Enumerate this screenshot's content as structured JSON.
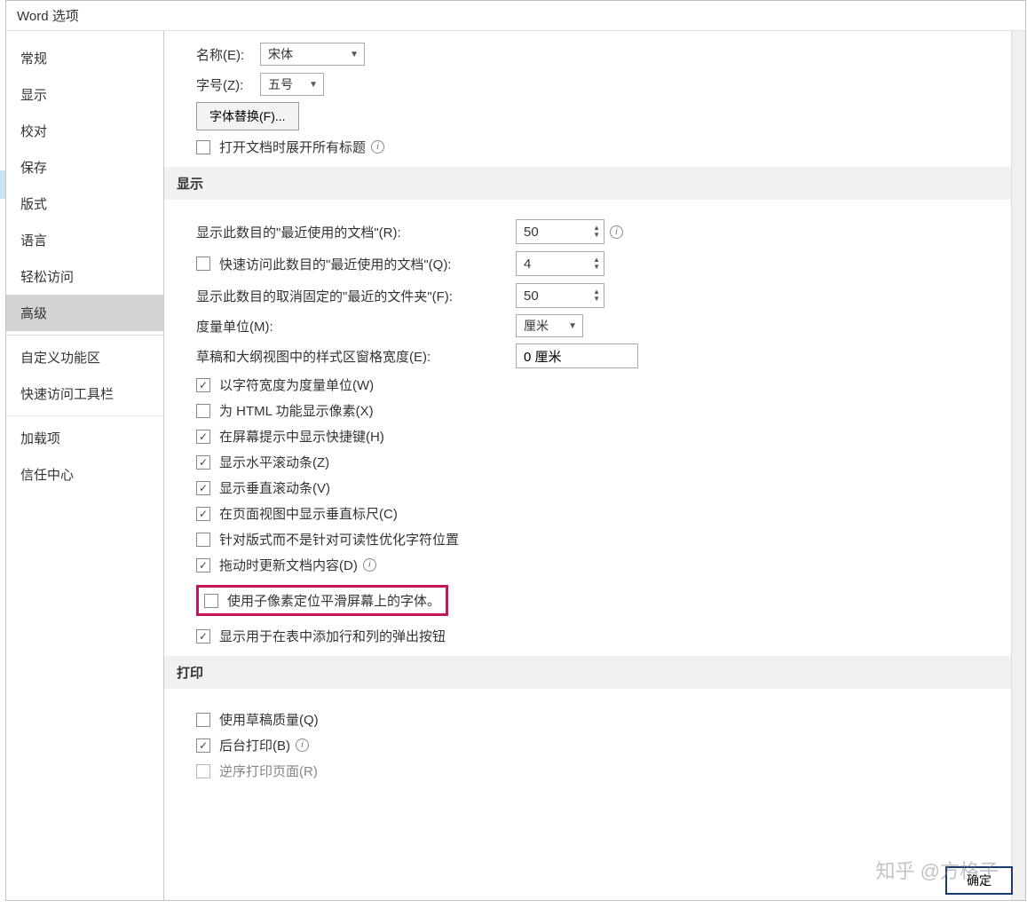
{
  "title": "Word 选项",
  "sidebar": {
    "items": [
      {
        "label": "常规"
      },
      {
        "label": "显示"
      },
      {
        "label": "校对"
      },
      {
        "label": "保存"
      },
      {
        "label": "版式"
      },
      {
        "label": "语言"
      },
      {
        "label": "轻松访问"
      },
      {
        "label": "高级",
        "selected": true
      },
      {
        "label": "自定义功能区"
      },
      {
        "label": "快速访问工具栏"
      },
      {
        "label": "加载项"
      },
      {
        "label": "信任中心"
      }
    ]
  },
  "font": {
    "name_label": "名称(E):",
    "name_value": "宋体",
    "size_label": "字号(Z):",
    "size_value": "五号",
    "substitute_btn": "字体替换(F)...",
    "expand_headings": "打开文档时展开所有标题"
  },
  "display": {
    "header": "显示",
    "recent_label": "显示此数目的\"最近使用的文档\"(R):",
    "recent_value": "50",
    "quick_label": "快速访问此数目的\"最近使用的文档\"(Q):",
    "quick_value": "4",
    "unpinned_label": "显示此数目的取消固定的\"最近的文件夹\"(F):",
    "unpinned_value": "50",
    "unit_label": "度量单位(M):",
    "unit_value": "厘米",
    "stylepane_label": "草稿和大纲视图中的样式区窗格宽度(E):",
    "stylepane_value": "0 厘米",
    "cb_charwidth": "以字符宽度为度量单位(W)",
    "cb_htmlpx": "为 HTML 功能显示像素(X)",
    "cb_shortcut": "在屏幕提示中显示快捷键(H)",
    "cb_hscroll": "显示水平滚动条(Z)",
    "cb_vscroll": "显示垂直滚动条(V)",
    "cb_vruler": "在页面视图中显示垂直标尺(C)",
    "cb_optchar": "针对版式而不是针对可读性优化字符位置",
    "cb_dragupdate": "拖动时更新文档内容(D)",
    "cb_subpixel": "使用子像素定位平滑屏幕上的字体。",
    "cb_tablepopup": "显示用于在表中添加行和列的弹出按钮"
  },
  "print": {
    "header": "打印",
    "cb_draft": "使用草稿质量(Q)",
    "cb_bg": "后台打印(B)",
    "cb_cut": "逆序打印页面(R)"
  },
  "footer": {
    "ok": "确定"
  },
  "watermark": "知乎 @方格子"
}
